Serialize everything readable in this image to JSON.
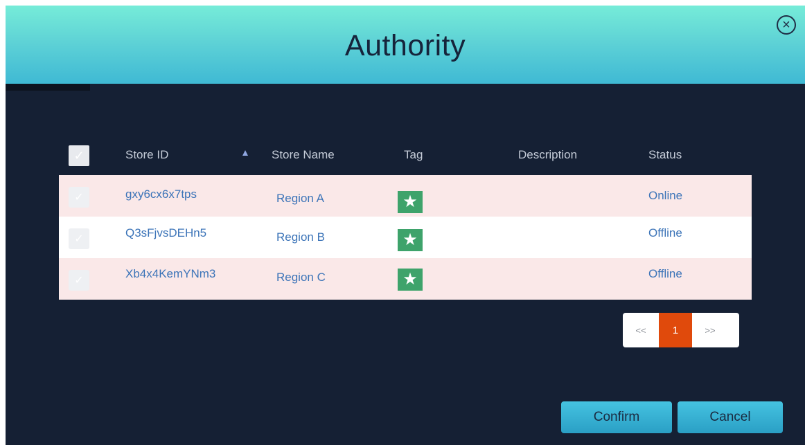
{
  "dialog": {
    "title": "Authority",
    "close_icon": "×"
  },
  "table": {
    "headers": {
      "store_id": "Store ID",
      "store_name": "Store Name",
      "tag": "Tag",
      "description": "Description",
      "status": "Status"
    },
    "sort": {
      "column": "store_id",
      "direction": "ascending"
    },
    "rows": [
      {
        "store_id": "gxy6cx6x7tps",
        "store_name": "Region A",
        "tag_icon": "★",
        "description": "",
        "status": "Online"
      },
      {
        "store_id": "Q3sFjvsDEHn5",
        "store_name": "Region B",
        "tag_icon": "★",
        "description": "",
        "status": "Offline"
      },
      {
        "store_id": "Xb4x4KemYNm3",
        "store_name": "Region C",
        "tag_icon": "★",
        "description": "",
        "status": "Offline"
      }
    ],
    "checkbox_mark": "✓"
  },
  "pagination": {
    "prev_label": "<<",
    "current_page": "1",
    "next_label": ">>"
  },
  "actions": {
    "confirm_label": "Confirm",
    "cancel_label": "Cancel"
  },
  "colors": {
    "header_gradient_top": "#76ecd8",
    "header_gradient_bottom": "#3fb9d4",
    "background": "#152034",
    "row_highlight": "#fae8e8",
    "link_text": "#3c74b8",
    "tag_green": "#3ea36b",
    "pager_active": "#e04a0c",
    "button": "#2a9fc5"
  }
}
